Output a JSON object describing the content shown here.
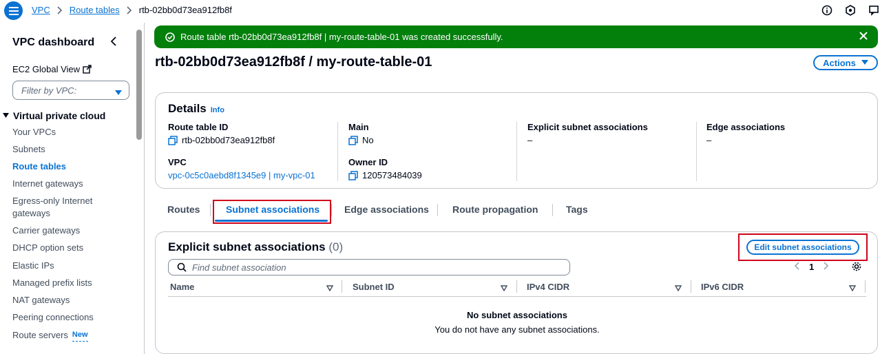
{
  "breadcrumb": {
    "items": [
      "VPC",
      "Route tables"
    ],
    "current": "rtb-02bb0d73ea912fb8f"
  },
  "sidebar": {
    "title": "VPC dashboard",
    "global_view": "EC2 Global View",
    "filter_placeholder": "Filter by VPC:",
    "section": "Virtual private cloud",
    "items": [
      {
        "label": "Your VPCs"
      },
      {
        "label": "Subnets"
      },
      {
        "label": "Route tables"
      },
      {
        "label": "Internet gateways"
      },
      {
        "label": "Egress-only Internet gateways"
      },
      {
        "label": "Carrier gateways"
      },
      {
        "label": "DHCP option sets"
      },
      {
        "label": "Elastic IPs"
      },
      {
        "label": "Managed prefix lists"
      },
      {
        "label": "NAT gateways"
      },
      {
        "label": "Peering connections"
      },
      {
        "label": "Route servers"
      }
    ],
    "new_badge": "New"
  },
  "flash": {
    "message": "Route table rtb-02bb0d73ea912fb8f | my-route-table-01 was created successfully."
  },
  "page": {
    "title": "rtb-02bb0d73ea912fb8f / my-route-table-01",
    "actions_label": "Actions"
  },
  "details": {
    "title": "Details",
    "info": "Info",
    "route_table_id_label": "Route table ID",
    "route_table_id": "rtb-02bb0d73ea912fb8f",
    "main_label": "Main",
    "main": "No",
    "explicit_label": "Explicit subnet associations",
    "explicit": "–",
    "edge_label": "Edge associations",
    "edge": "–",
    "vpc_label": "VPC",
    "vpc": "vpc-0c5c0aebd8f1345e9 | my-vpc-01",
    "owner_label": "Owner ID",
    "owner": "120573484039"
  },
  "tabs": [
    "Routes",
    "Subnet associations",
    "Edge associations",
    "Route propagation",
    "Tags"
  ],
  "associations": {
    "title": "Explicit subnet associations",
    "count": "(0)",
    "edit_label": "Edit subnet associations",
    "search_placeholder": "Find subnet association",
    "page": "1",
    "columns": [
      "Name",
      "Subnet ID",
      "IPv4 CIDR",
      "IPv6 CIDR"
    ],
    "empty_title": "No subnet associations",
    "empty_desc": "You do not have any subnet associations."
  },
  "colors": {
    "accent": "#0972d3",
    "success": "#037f0c",
    "highlight": "#d0021b"
  }
}
